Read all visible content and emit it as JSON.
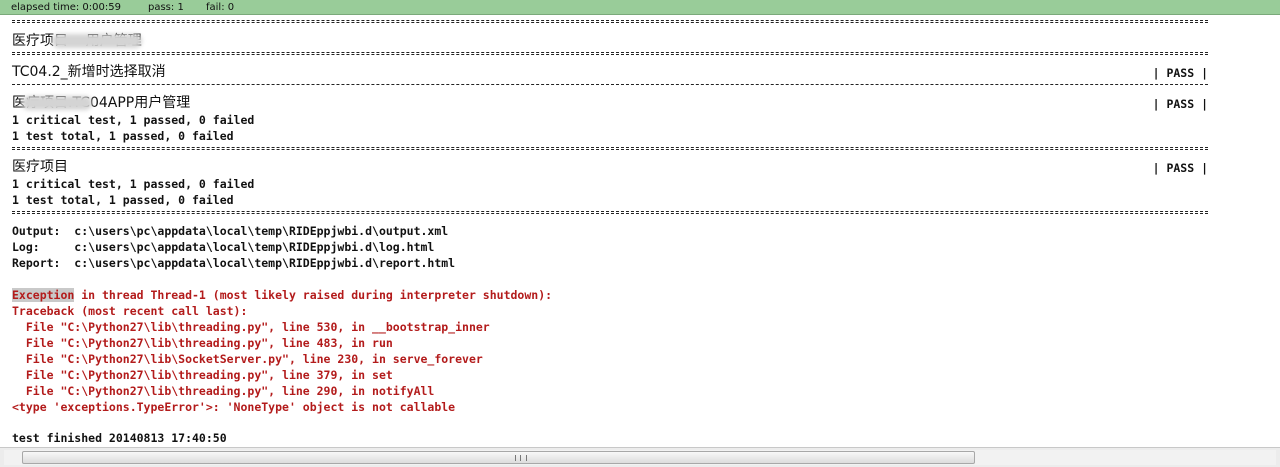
{
  "status": {
    "elapsed": "elapsed time: 0:00:59",
    "pass": "pass: 1",
    "fail": "fail: 0"
  },
  "log": {
    "top_suite": "医疗项目    用户管理",
    "test_name": "TC04.2_新增时选择取消",
    "pass_label": "| PASS |",
    "sub_suite": "医疗项目.TC04APP用户管理",
    "critical_line": "1 critical test, 1 passed, 0 failed",
    "total_line": "1 test total, 1 passed, 0 failed",
    "root_suite": "医疗项目",
    "output_line": "Output:  c:\\users\\pc\\appdata\\local\\temp\\RIDEppjwbi.d\\output.xml",
    "log_line": "Log:     c:\\users\\pc\\appdata\\local\\temp\\RIDEppjwbi.d\\log.html",
    "report_line": "Report:  c:\\users\\pc\\appdata\\local\\temp\\RIDEppjwbi.d\\report.html",
    "exception_word": "Exception",
    "exception_rest": " in thread Thread-1 (most likely raised during interpreter shutdown):",
    "traceback": "Traceback (most recent call last):",
    "frames": [
      "  File \"C:\\Python27\\lib\\threading.py\", line 530, in __bootstrap_inner",
      "  File \"C:\\Python27\\lib\\threading.py\", line 483, in run",
      "  File \"C:\\Python27\\lib\\SocketServer.py\", line 230, in serve_forever",
      "  File \"C:\\Python27\\lib\\threading.py\", line 379, in set",
      "  File \"C:\\Python27\\lib\\threading.py\", line 290, in notifyAll"
    ],
    "error_line": "<type 'exceptions.TypeError'>: 'NoneType' object is not callable",
    "finished": "test finished 20140813 17:40:50"
  },
  "colors": {
    "status_bg": "#99cc99",
    "error_text": "#b31b1b"
  },
  "icons": {
    "scroll_grip": "grip-icon"
  }
}
